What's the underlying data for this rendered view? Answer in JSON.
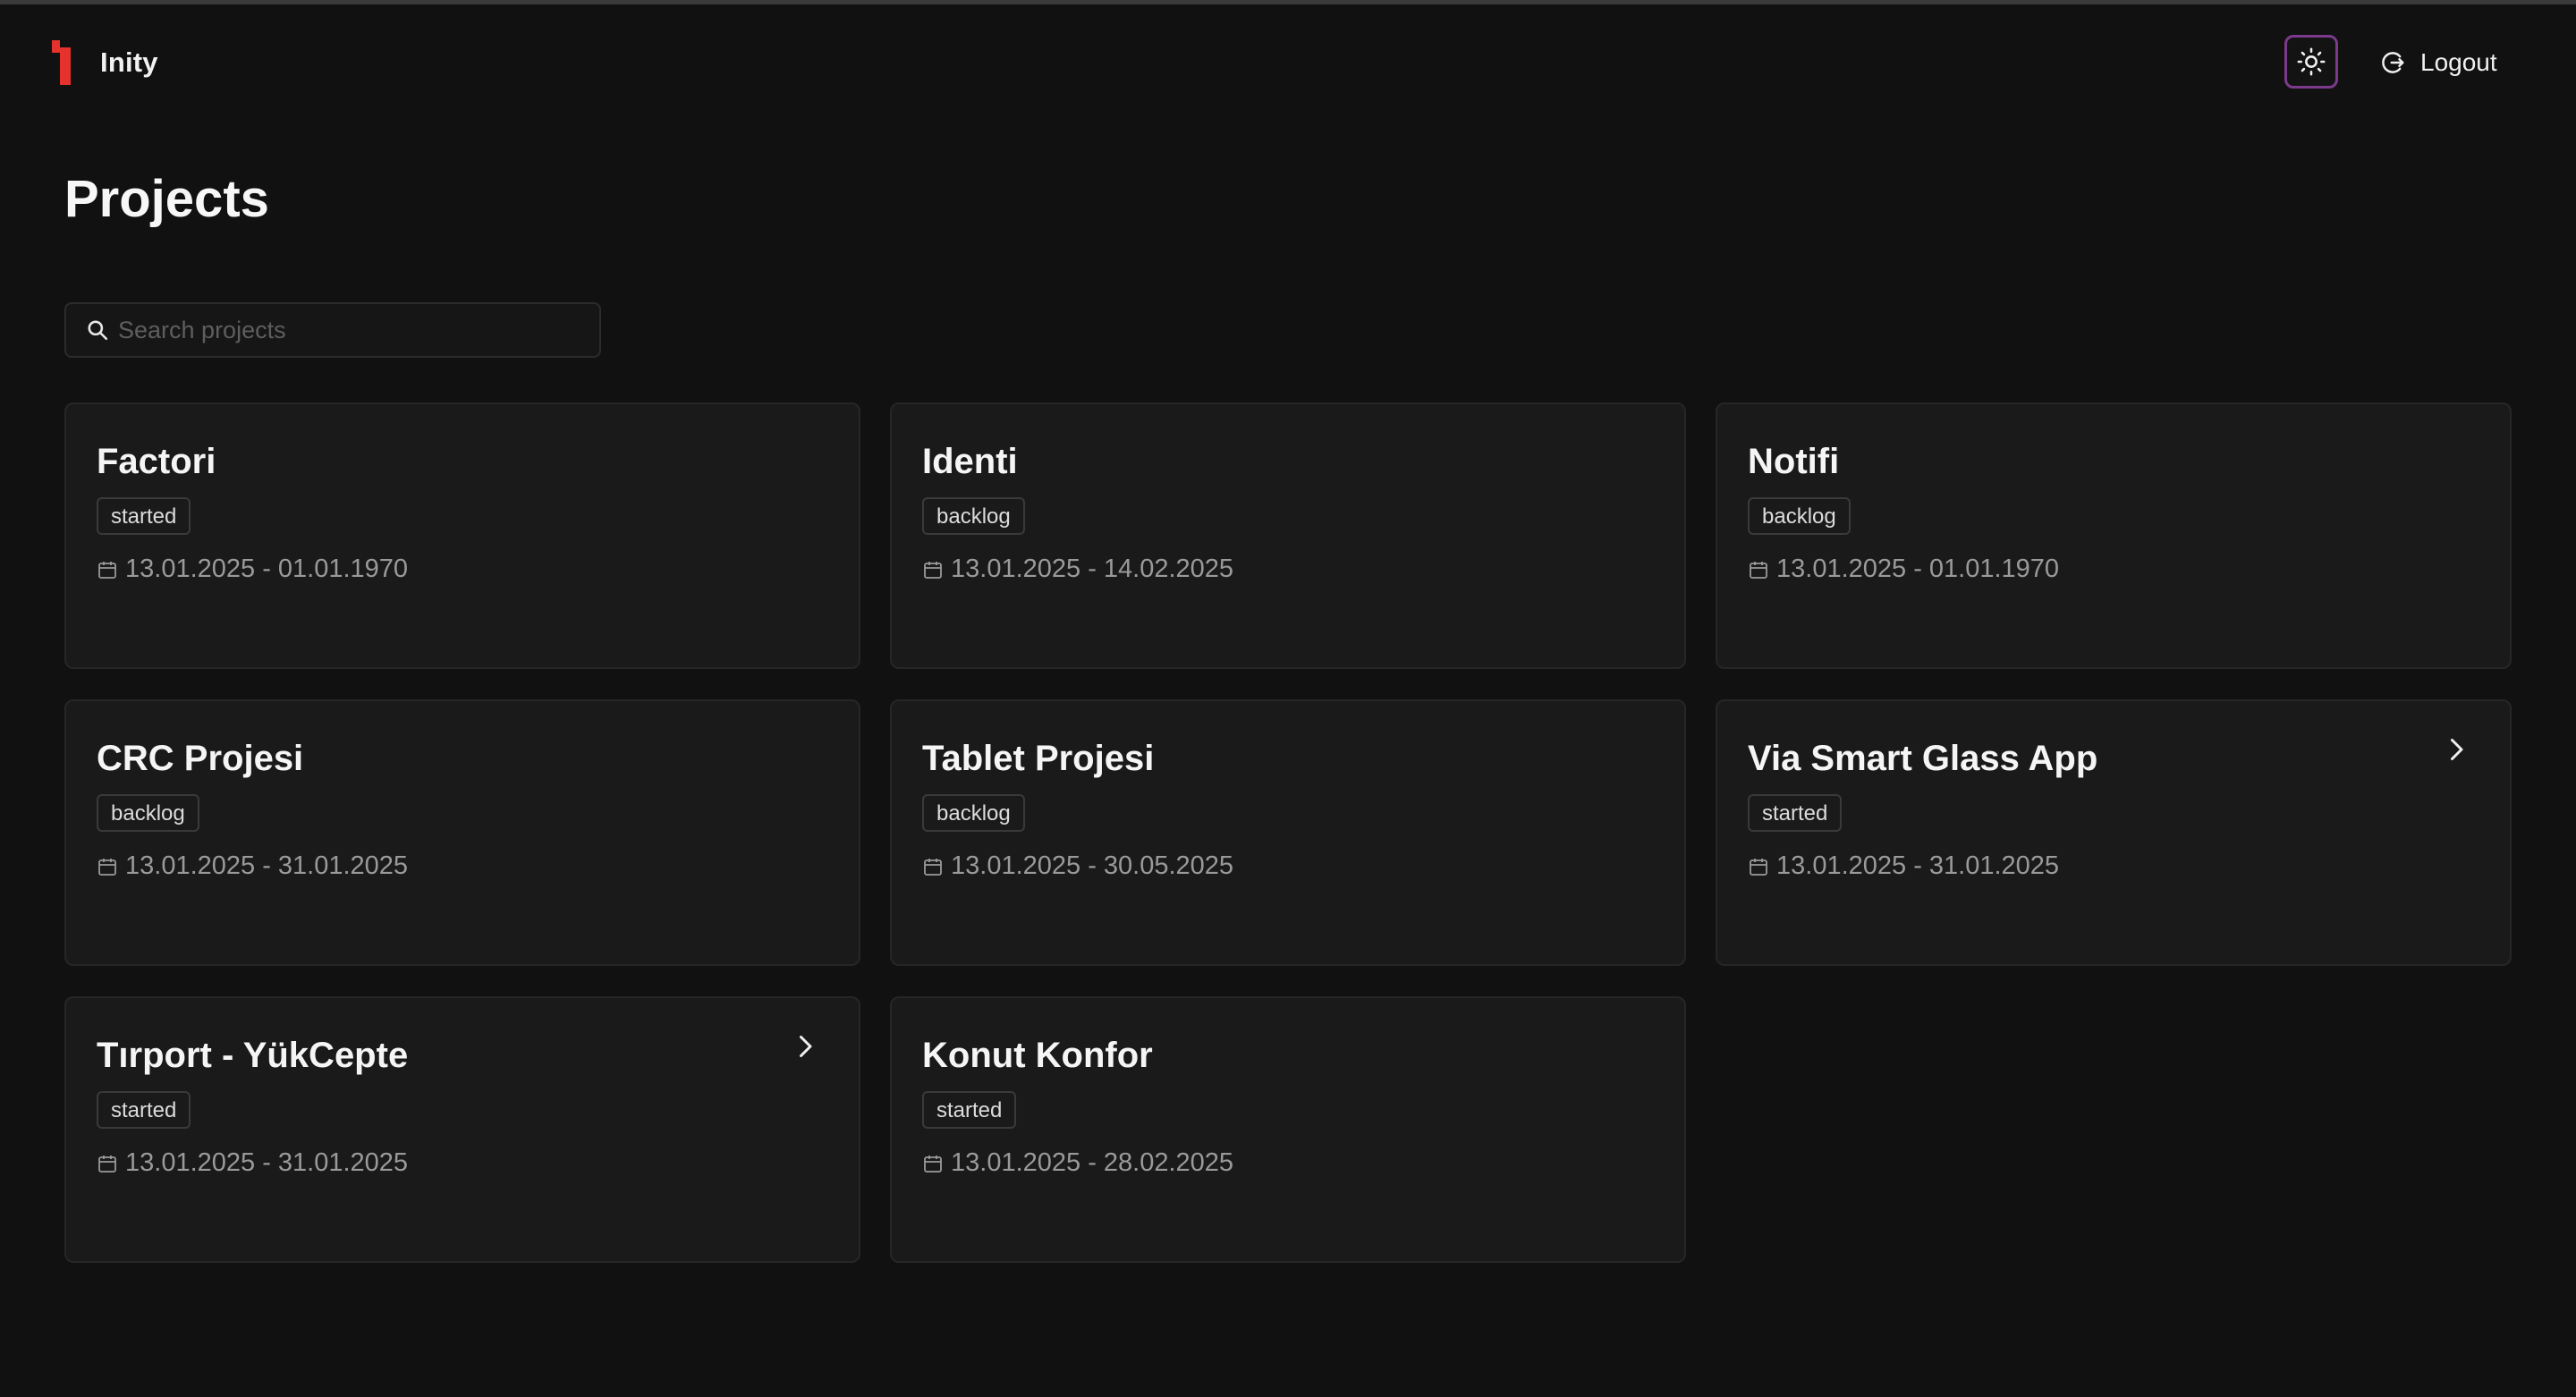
{
  "header": {
    "brand_name": "Inity",
    "logout_label": "Logout"
  },
  "page": {
    "title": "Projects"
  },
  "search": {
    "placeholder": "Search projects",
    "value": ""
  },
  "projects": [
    {
      "name": "Factori",
      "status": "started",
      "dates": "13.01.2025 - 01.01.1970",
      "has_chevron": false
    },
    {
      "name": "Identi",
      "status": "backlog",
      "dates": "13.01.2025 - 14.02.2025",
      "has_chevron": false
    },
    {
      "name": "Notifi",
      "status": "backlog",
      "dates": "13.01.2025 - 01.01.1970",
      "has_chevron": false
    },
    {
      "name": "CRC Projesi",
      "status": "backlog",
      "dates": "13.01.2025 - 31.01.2025",
      "has_chevron": false
    },
    {
      "name": "Tablet Projesi",
      "status": "backlog",
      "dates": "13.01.2025 - 30.05.2025",
      "has_chevron": false
    },
    {
      "name": "Via Smart Glass App",
      "status": "started",
      "dates": "13.01.2025 - 31.01.2025",
      "has_chevron": true
    },
    {
      "name": "Tırport - YükCepte",
      "status": "started",
      "dates": "13.01.2025 - 31.01.2025",
      "has_chevron": true
    },
    {
      "name": "Konut Konfor",
      "status": "started",
      "dates": "13.01.2025 - 28.02.2025",
      "has_chevron": false
    }
  ],
  "icons": {
    "logo": "inity-logo",
    "theme": "sun-icon",
    "logout": "logout-icon",
    "search": "search-icon",
    "date": "calendar-icon",
    "open": "chevron-right-icon"
  },
  "colors": {
    "background": "#111111",
    "card": "#1a1a1a",
    "brand_red": "#e5322d",
    "theme_border": "#7b3a8c"
  }
}
